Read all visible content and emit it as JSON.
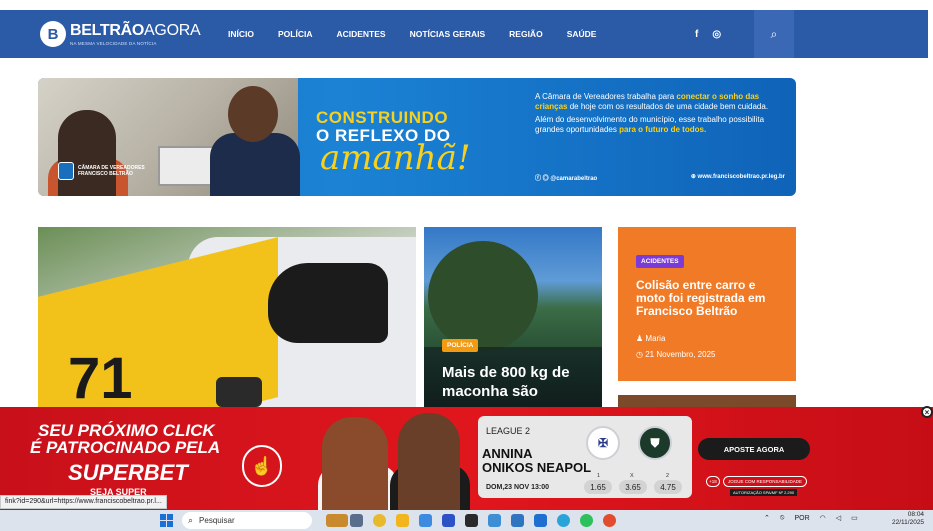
{
  "site": {
    "logo_name_bold": "BELTRÃO",
    "logo_name_thin": "AGORA",
    "logo_tagline": "NA MESMA VELOCIDADE DA NOTÍCIA",
    "menu": [
      "INÍCIO",
      "POLÍCIA",
      "ACIDENTES",
      "NOTÍCIAS GERAIS",
      "REGIÃO",
      "SAÚDE"
    ],
    "nav_color": "#2b5aa6"
  },
  "banner": {
    "title_line1": "CONSTRUINDO",
    "title_line2": "O REFLEXO DO",
    "title_script": "amanhã!",
    "council_line1": "CÂMARA DE VEREADORES",
    "council_line2": "FRANCISCO BELTRÃO",
    "copy_p1_pre": "A Câmara de Vereadores  trabalha para ",
    "copy_p1_hl": "conectar o sonho das crianças",
    "copy_p1_post": " de hoje com os resultados de uma cidade bem cuidada.",
    "copy_p2_pre": "Além do desenvolvimento do município, esse trabalho possibilita grandes oportunidades ",
    "copy_p2_hl": "para o futuro de todos.",
    "social_handle": "@camarabeltrao",
    "website": "www.franciscobeltrao.pr.leg.br"
  },
  "cards": {
    "mid": {
      "badge": "POLÍCIA",
      "title": "Mais de 800 kg de maconha são"
    },
    "right": {
      "badge": "ACIDENTES",
      "title": "Colisão entre carro e moto foi registrada em Francisco Beltrão",
      "author": "Maria",
      "date": "21 Novembro, 2025"
    },
    "big": {
      "number": "71"
    }
  },
  "ad": {
    "line1": "SEU PRÓXIMO CLICK",
    "line2": "É PATROCINADO PELA",
    "brand": "SUPERBET",
    "sub": "SEJA SUPER",
    "league": "LEAGUE 2",
    "team1": "ANNINA",
    "team2": "ONIKOS NEAPOL",
    "date": "DOM,23 NOV 13:00",
    "odd_labels": [
      "1",
      "X",
      "2"
    ],
    "odds": [
      "1.65",
      "3.65",
      "4.75"
    ],
    "cta": "APOSTE AGORA",
    "age": "+18",
    "responsible": "JOGUE COM RESPONSABILIDADE",
    "authorization": "AUTORIZAÇÃO SPA/MF Nº 2.290",
    "close": "×"
  },
  "status_url": "fink?id=290&url=https://www.franciscobeltrao.pr.l...",
  "taskbar": {
    "search_placeholder": "Pesquisar",
    "language": "POR",
    "time": "08:04",
    "date": "22/11/2025"
  }
}
